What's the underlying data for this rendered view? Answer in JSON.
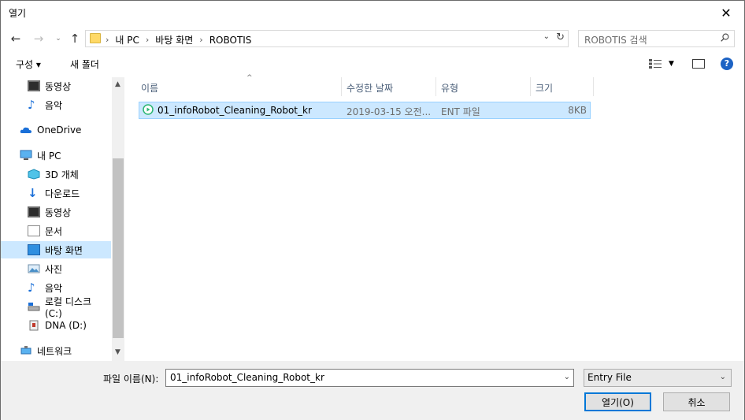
{
  "title": "열기",
  "address": {
    "crumbs": [
      "내 PC",
      "바탕 화면",
      "ROBOTIS"
    ]
  },
  "search": {
    "placeholder": "ROBOTIS 검색"
  },
  "toolbar": {
    "organize": "구성 ▾",
    "new_folder": "새 폴더"
  },
  "nav": {
    "items": [
      {
        "label": "동영상",
        "icon": "video-icon"
      },
      {
        "label": "음악",
        "icon": "music-icon"
      },
      {
        "label": "OneDrive",
        "icon": "cloud-icon"
      },
      {
        "label": "내 PC",
        "icon": "computer-icon"
      },
      {
        "label": "3D 개체",
        "icon": "3d-objects-icon"
      },
      {
        "label": "다운로드",
        "icon": "download-icon"
      },
      {
        "label": "동영상",
        "icon": "video-icon"
      },
      {
        "label": "문서",
        "icon": "document-icon"
      },
      {
        "label": "바탕 화면",
        "icon": "desktop-icon"
      },
      {
        "label": "사진",
        "icon": "pictures-icon"
      },
      {
        "label": "음악",
        "icon": "music-icon"
      },
      {
        "label": "로컬 디스크 (C:)",
        "icon": "disk-icon"
      },
      {
        "label": "DNA (D:)",
        "icon": "usb-drive-icon"
      },
      {
        "label": "네트워크",
        "icon": "network-icon"
      }
    ]
  },
  "columns": {
    "name": "이름",
    "modified": "수정한 날짜",
    "type": "유형",
    "size": "크기"
  },
  "files": [
    {
      "name": "01_infoRobot_Cleaning_Robot_kr",
      "modified": "2019-03-15 오전...",
      "type": "ENT 파일",
      "size": "8KB"
    }
  ],
  "bottom": {
    "filename_label": "파일 이름(N):",
    "filename_value": "01_infoRobot_Cleaning_Robot_kr",
    "filetype_value": "Entry File",
    "open_label": "열기(O)",
    "cancel_label": "취소"
  },
  "colors": {
    "accent": "#0078d7",
    "selection": "#cce8ff",
    "help": "#1d63c4"
  }
}
